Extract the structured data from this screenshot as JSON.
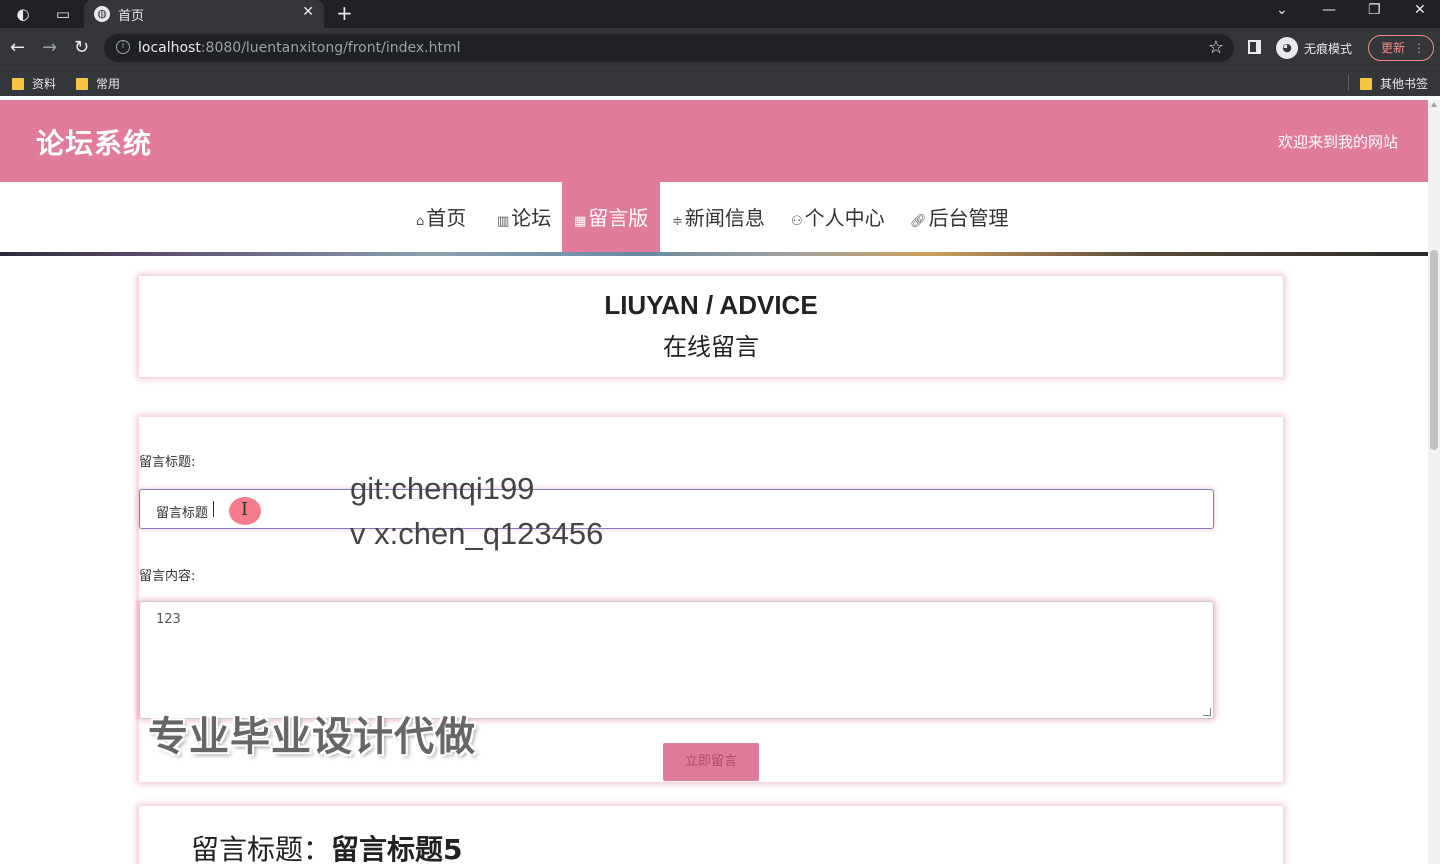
{
  "browser": {
    "tab_title": "首页",
    "url_host": "localhost",
    "url_rest": ":8080/luentanxitong/front/index.html",
    "incognito_label": "无痕模式",
    "update_label": "更新",
    "bookmarks": [
      "资料",
      "常用"
    ],
    "other_bookmarks": "其他书签"
  },
  "site": {
    "title": "论坛系统",
    "welcome": "欢迎来到我的网站",
    "nav": [
      {
        "icon": "⌂",
        "label": "首页"
      },
      {
        "icon": "▥",
        "label": "论坛"
      },
      {
        "icon": "▦",
        "label": "留言版"
      },
      {
        "icon": "≑",
        "label": "新闻信息"
      },
      {
        "icon": "⚇",
        "label": "个人中心"
      },
      {
        "icon": "🔗︎",
        "label": "后台管理"
      }
    ]
  },
  "heading": {
    "en": "LIUYAN / ADVICE",
    "cn": "在线留言"
  },
  "form": {
    "title_label": "留言标题:",
    "title_value": "留言标题",
    "content_label": "留言内容:",
    "content_value": "123",
    "submit_label": "立即留言"
  },
  "list": {
    "first_item_prefix": "留言标题：",
    "first_item_value": "留言标题5"
  },
  "overlay": {
    "git": "git:chenqi199",
    "vx": "v x:chen_q123456",
    "ad": "专业毕业设计代做"
  },
  "colors": {
    "accent": "#e07b9a"
  }
}
